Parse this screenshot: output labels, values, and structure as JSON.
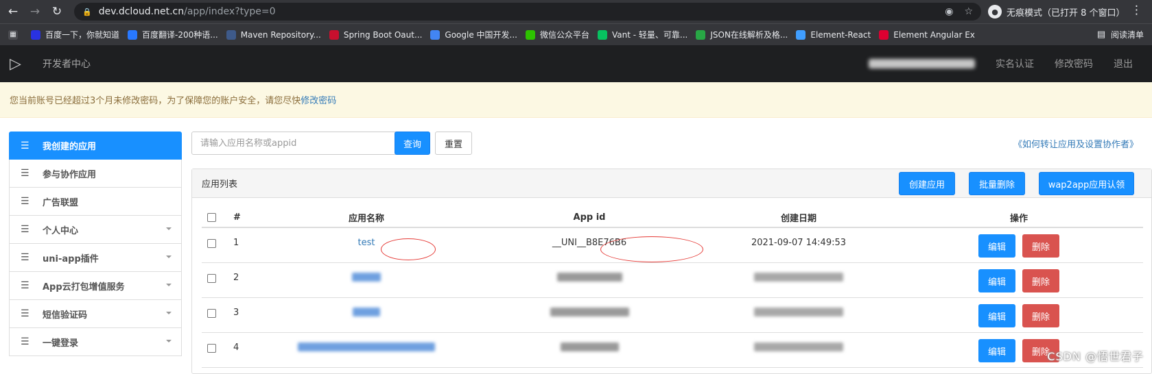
{
  "browser": {
    "url_host": "dev.dcloud.net.cn",
    "url_path": "/app/index?type=0",
    "incognito_label": "无痕模式（已打开 8 个窗口）",
    "bookmarks": [
      {
        "label": "百度一下，你就知道",
        "icon": "baidu-icon",
        "color": "#2932e1"
      },
      {
        "label": "百度翻译-200种语...",
        "icon": "translate-icon",
        "color": "#2878ff"
      },
      {
        "label": "Maven Repository...",
        "icon": "maven-icon",
        "color": "#3e5a8a"
      },
      {
        "label": "Spring Boot Oaut...",
        "icon": "c-icon",
        "color": "#c8102e"
      },
      {
        "label": "Google 中国开发...",
        "icon": "google-icon",
        "color": "#4285f4"
      },
      {
        "label": "微信公众平台",
        "icon": "wechat-icon",
        "color": "#2dc100"
      },
      {
        "label": "Vant - 轻量、可靠...",
        "icon": "vant-icon",
        "color": "#07c160"
      },
      {
        "label": "JSON在线解析及格...",
        "icon": "json-icon",
        "color": "#28a745"
      },
      {
        "label": "Element-React",
        "icon": "element-icon",
        "color": "#409eff"
      },
      {
        "label": "Element Angular Ex",
        "icon": "angular-icon",
        "color": "#dd0031"
      }
    ],
    "reading_list": "阅读清单"
  },
  "topnav": {
    "brand": "开发者中心",
    "links": [
      "实名认证",
      "修改密码",
      "退出"
    ]
  },
  "alert": {
    "text": "您当前账号已经超过3个月未修改密码，为了保障您的账户安全，请您尽快",
    "link": "修改密码"
  },
  "sidebar": {
    "items": [
      {
        "label": "我创建的应用",
        "active": true,
        "caret": false
      },
      {
        "label": "参与协作应用",
        "active": false,
        "caret": false
      },
      {
        "label": "广告联盟",
        "active": false,
        "caret": false
      },
      {
        "label": "个人中心",
        "active": false,
        "caret": true
      },
      {
        "label": "uni-app插件",
        "active": false,
        "caret": true
      },
      {
        "label": "App云打包增值服务",
        "active": false,
        "caret": true
      },
      {
        "label": "短信验证码",
        "active": false,
        "caret": true
      },
      {
        "label": "一键登录",
        "active": false,
        "caret": true
      }
    ]
  },
  "search": {
    "placeholder": "请输入应用名称或appid",
    "query_label": "查询",
    "reset_label": "重置"
  },
  "help_link": "《如何转让应用及设置协作者》",
  "panel": {
    "title": "应用列表",
    "create_label": "创建应用",
    "batch_delete_label": "批量删除",
    "wap2app_label": "wap2app应用认领"
  },
  "table": {
    "headers": [
      "#",
      "应用名称",
      "App id",
      "创建日期",
      "操作"
    ],
    "edit_label": "编辑",
    "delete_label": "删除",
    "rows": [
      {
        "index": "1",
        "name": "test",
        "appid": "__UNI__B8E76B6",
        "date": "2021-09-07 14:49:53"
      },
      {
        "index": "2",
        "name": "",
        "appid": "",
        "date": ""
      },
      {
        "index": "3",
        "name": "",
        "appid": "",
        "date": ""
      },
      {
        "index": "4",
        "name": "",
        "appid": "",
        "date": ""
      }
    ]
  },
  "watermark": "CSDN @悟世君子"
}
